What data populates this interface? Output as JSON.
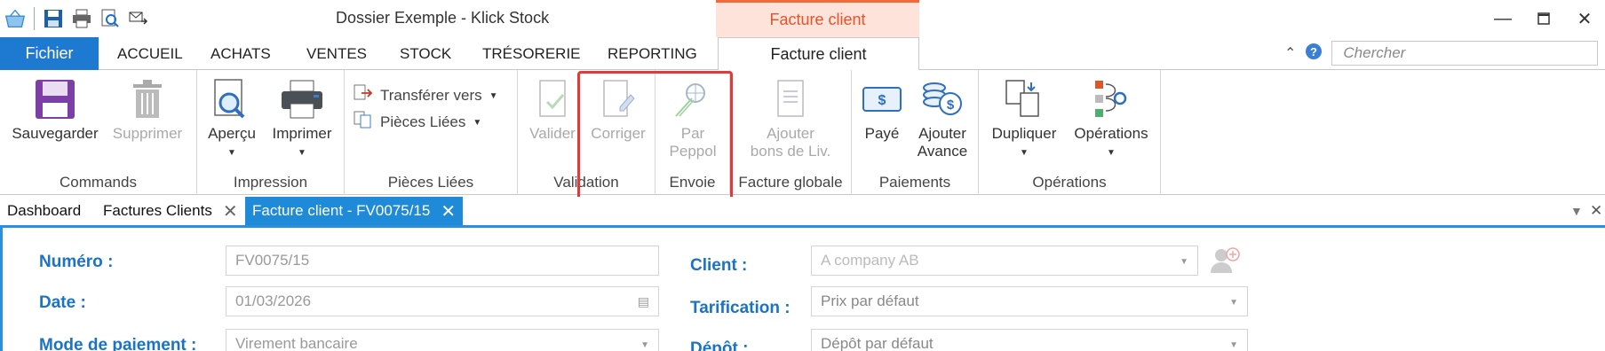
{
  "window": {
    "title": "Dossier Exemple - Klick Stock",
    "context_tab_header": "Facture client"
  },
  "tabs": {
    "file": "Fichier",
    "items": [
      "ACCUEIL",
      "ACHATS",
      "VENTES",
      "STOCK",
      "TRÉSORERIE",
      "REPORTING"
    ],
    "active": "Facture client"
  },
  "search": {
    "placeholder": "Chercher"
  },
  "ribbon": {
    "commands": {
      "label": "Commands",
      "save": "Sauvegarder",
      "delete": "Supprimer"
    },
    "impression": {
      "label": "Impression",
      "preview": "Aperçu",
      "print": "Imprimer"
    },
    "pieces": {
      "label": "Pièces Liées",
      "transfer": "Transférer vers",
      "linked": "Pièces Liées"
    },
    "validation": {
      "label": "Validation",
      "validate": "Valider",
      "correct": "Corriger"
    },
    "envoie": {
      "label": "Envoie",
      "peppol_1": "Par",
      "peppol_2": "Peppol"
    },
    "facture_globale": {
      "label": "Facture globale",
      "add_1": "Ajouter",
      "add_2": "bons de Liv."
    },
    "paiements": {
      "label": "Paiements",
      "paid": "Payé",
      "advance_1": "Ajouter",
      "advance_2": "Avance"
    },
    "operations": {
      "label": "Opérations",
      "duplicate": "Dupliquer",
      "operations": "Opérations"
    }
  },
  "doc_tabs": [
    {
      "label": "Dashboard",
      "closable": false
    },
    {
      "label": "Factures Clients",
      "closable": true
    },
    {
      "label": "Facture client - FV0075/15",
      "closable": true,
      "active": true
    }
  ],
  "form": {
    "numero": {
      "label": "Numéro :",
      "value": "FV0075/15"
    },
    "date": {
      "label": "Date :",
      "value": "01/03/2026"
    },
    "mode": {
      "label": "Mode de paiement :",
      "value": "Virement bancaire"
    },
    "client": {
      "label": "Client :",
      "value": "A company AB"
    },
    "tarification": {
      "label": "Tarification :",
      "value": "Prix par défaut"
    },
    "depot": {
      "label": "Dépôt :",
      "value": "Dépôt par défaut"
    }
  },
  "colors": {
    "accent": "#1e7ad0",
    "context": "#e0552a",
    "highlight": "#e03b3b",
    "label_blue": "#1a73c4"
  }
}
